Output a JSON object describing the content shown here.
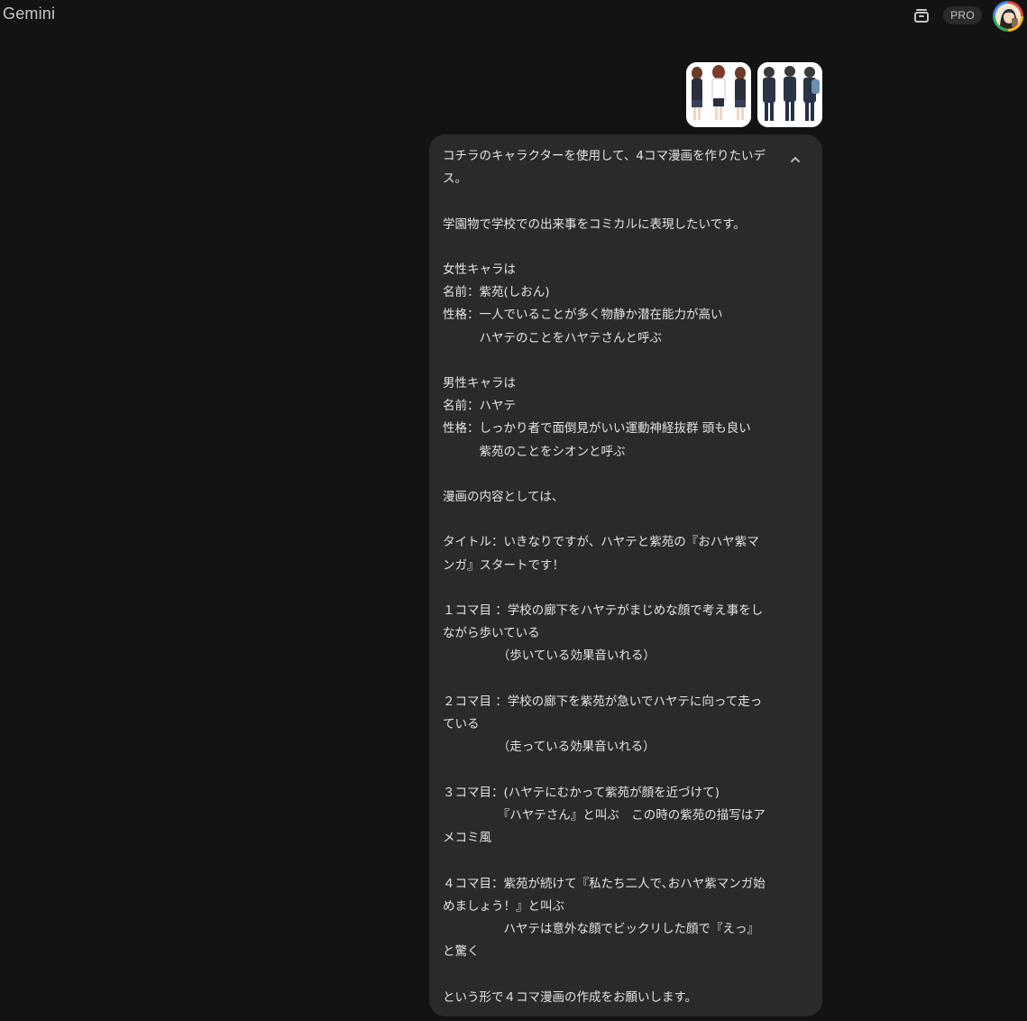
{
  "header": {
    "brand": "Gemini",
    "pro_badge": "PRO",
    "history_icon": "clear-history-icon",
    "avatar_icon": "user-avatar"
  },
  "attachments": [
    {
      "icon": "image-thumbnail-female-character"
    },
    {
      "icon": "image-thumbnail-male-character"
    }
  ],
  "message": {
    "collapse_icon": "chevron-up-icon",
    "text": "コチラのキャラクターを使用して、4コマ漫画を作りたいデス。\n\n学園物で学校での出来事をコミカルに表現したいです。\n\n女性キャラは\n名前：紫苑(しおん)\n性格：一人でいることが多く物静か潜在能力が高い\n　　　ハヤテのことをハヤテさんと呼ぶ\n\n男性キャラは\n名前：ハヤテ\n性格：しっかり者で面倒見がいい運動神経抜群 頭も良い\n　　　紫苑のことをシオンと呼ぶ\n\n漫画の内容としては、\n\nタイトル：いきなりですが、ハヤテと紫苑の『おハヤ紫マンガ』スタートです！\n\n１コマ目 ：学校の廊下をハヤテがまじめな顔で考え事をしながら歩いている\n　　　　　（歩いている効果音いれる）\n\n２コマ目 ：学校の廊下を紫苑が急いでハヤテに向って走っている\n　　　　　（走っている効果音いれる）\n\n３コマ目：(ハヤテにむかって紫苑が顔を近づけて)\n　　　　　『ハヤテさん』と叫ぶ　この時の紫苑の描写はアメコミ風\n\n４コマ目：紫苑が続けて『私たち二人で､おハヤ紫マンガ始めましょう！』と叫ぶ\n　　　　　ハヤテは意外な顔でビックリした顔で『えっ』と驚く\n\nという形で４コマ漫画の作成をお願いします。"
  },
  "colors": {
    "background": "#131314",
    "bubble": "#282a2c",
    "text": "#e3e3e3"
  }
}
